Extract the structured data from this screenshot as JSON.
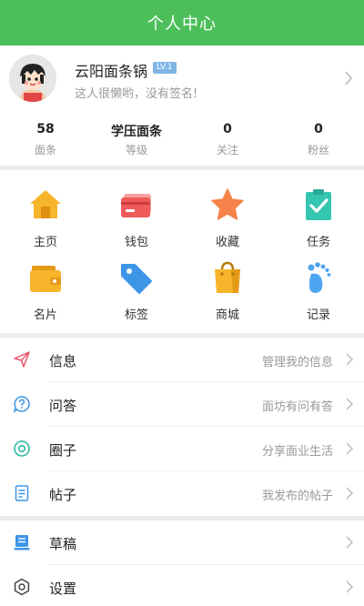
{
  "header": {
    "title": "个人中心"
  },
  "profile": {
    "username": "云阳面条锅",
    "level": "LV.1",
    "signature": "这人很懒哟，没有签名!"
  },
  "stats": [
    {
      "value": "58",
      "label": "面条"
    },
    {
      "value": "学压面条",
      "label": "等级"
    },
    {
      "value": "0",
      "label": "关注"
    },
    {
      "value": "0",
      "label": "粉丝"
    }
  ],
  "grid": [
    {
      "label": "主页",
      "icon": "home-icon",
      "color": "#f7b52c"
    },
    {
      "label": "钱包",
      "icon": "wallet-card-icon",
      "color": "#ef5a5a"
    },
    {
      "label": "收藏",
      "icon": "star-icon",
      "color": "#f5834a"
    },
    {
      "label": "任务",
      "icon": "clipboard-check-icon",
      "color": "#35c6b2"
    },
    {
      "label": "名片",
      "icon": "card-wallet-icon",
      "color": "#f7b52c"
    },
    {
      "label": "标签",
      "icon": "tag-icon",
      "color": "#3d95e8"
    },
    {
      "label": "商城",
      "icon": "shopping-bag-icon",
      "color": "#f7b52c"
    },
    {
      "label": "记录",
      "icon": "footprint-icon",
      "color": "#4ea6f0"
    }
  ],
  "menu1": [
    {
      "label": "信息",
      "desc": "管理我的信息",
      "icon": "paper-plane-icon"
    },
    {
      "label": "问答",
      "desc": "面坊有问有答",
      "icon": "question-icon"
    },
    {
      "label": "圈子",
      "desc": "分享面业生活",
      "icon": "circle-icon"
    },
    {
      "label": "帖子",
      "desc": "我发布的帖子",
      "icon": "document-icon"
    }
  ],
  "menu2": [
    {
      "label": "草稿",
      "icon": "draft-icon"
    },
    {
      "label": "设置",
      "icon": "settings-icon"
    }
  ],
  "colors": {
    "header": "#4cbf5a",
    "badge": "#7fb5e5"
  }
}
